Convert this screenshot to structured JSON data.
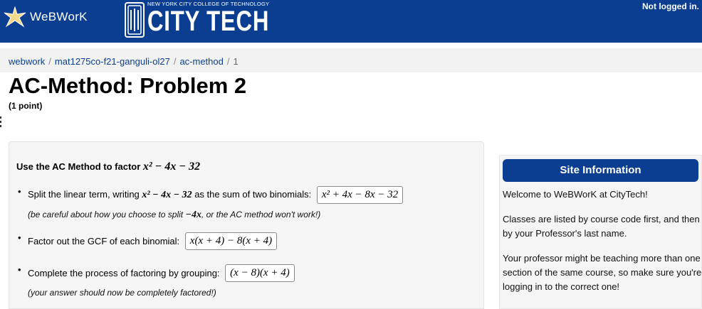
{
  "header": {
    "webwork_logo_text": "WeBWorK",
    "college_small": "NEW YORK CITY COLLEGE OF TECHNOLOGY",
    "college_big": "CITY TECH",
    "login_status": "Not logged in."
  },
  "breadcrumb": {
    "items": [
      "webwork",
      "mat1275co-f21-ganguli-ol27",
      "ac-method"
    ],
    "current": "1",
    "separator": "/"
  },
  "problem": {
    "title": "AC-Method: Problem 2",
    "points": "(1 point)",
    "prompt_text": "Use the AC Method to factor ",
    "prompt_math": "x² − 4x − 32",
    "step1_label": "Split the linear term, writing ",
    "step1_math": "x² − 4x − 32",
    "step1_label2": " as the sum of two binomials:",
    "step1_answer": "x² + 4x − 8x − 32",
    "step1_note_a": "(be careful about how you choose to split ",
    "step1_note_math": "−4x",
    "step1_note_b": ", or the AC method won't work!)",
    "step2_label": "Factor out the GCF of each binomial:",
    "step2_answer": "x(x + 4) − 8(x + 4)",
    "step3_label": "Complete the process of factoring by grouping:",
    "step3_answer": "(x − 8)(x + 4)",
    "step3_note": "(your answer should now be completely factored!)"
  },
  "site_info": {
    "heading": "Site Information",
    "p1": "Welcome to WeBWorK at CityTech!",
    "p2": "Classes are listed by course code first, and then by your Professor's last name.",
    "p3": "Your professor might be teaching more than one section of the same course, so make sure you're logging in to the correct one!"
  },
  "colors": {
    "header_blue": "#0b3e91",
    "panel_bg": "#f5f5f5"
  }
}
